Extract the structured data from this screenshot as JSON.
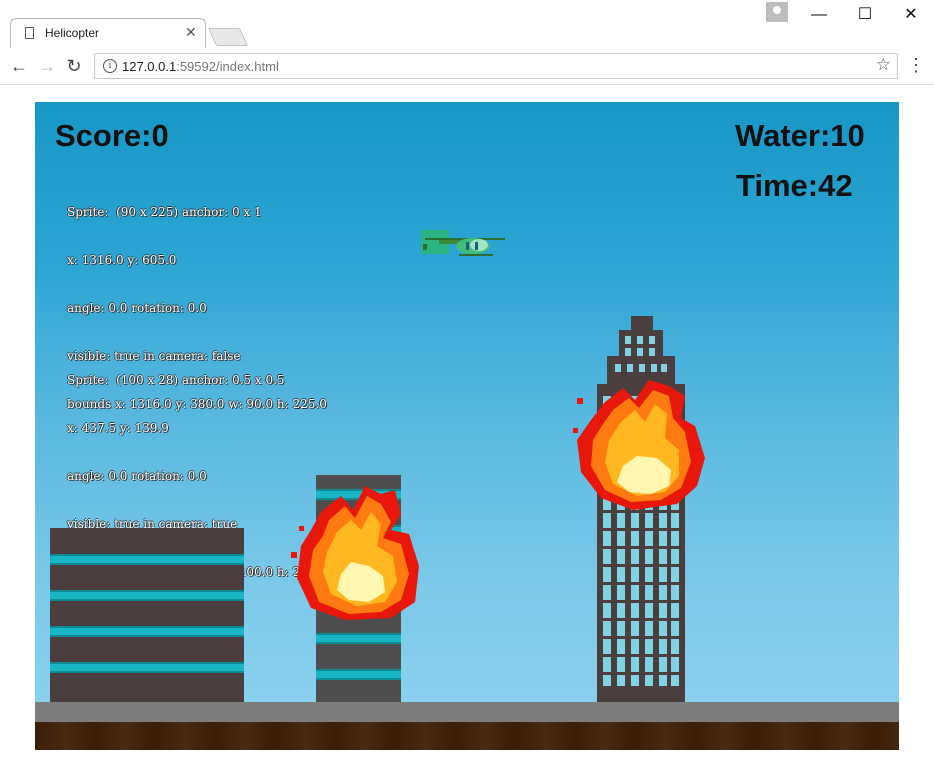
{
  "browser": {
    "tab_title": "Helicopter",
    "url_host": "127.0.0.1",
    "url_rest": ":59592/index.html"
  },
  "hud": {
    "score": "Score:0",
    "water": "Water:10",
    "time": "Time:42"
  },
  "debug": {
    "helicopter": [
      "Sprite:  (90 x 225) anchor: 0 x 1",
      "x: 1316.0 y: 605.0",
      "angle: 0.0 rotation: 0.0",
      "visible: true in camera: false",
      "bounds x: 1316.0 y: 380.0 w: 90.0 h: 225.0"
    ],
    "sprite2": [
      "Sprite:  (100 x 28) anchor: 0.5 x 0.5",
      "x: 437.5 y: 139.9",
      "angle: 0.0 rotation: 0.0",
      "visible: true in camera: true",
      "bounds x: 387.5 y: 125.9 w: 100.0 h: 28.0"
    ]
  },
  "colors": {
    "sky_top": "#1797c6",
    "sky_bottom": "#8ed3ef",
    "building": "#4a3e3e",
    "window": "#18b6c4",
    "road": "#7d7d7d",
    "dirt": "#3a1e08",
    "fire_outer": "#e8170c",
    "fire_mid": "#ff9a10",
    "fire_core": "#fff7b0"
  },
  "icons": {
    "back": "arrow-left-icon",
    "forward": "arrow-right-icon",
    "reload": "reload-icon",
    "info": "info-icon",
    "bookmark": "star-icon",
    "menu": "kebab-menu-icon"
  }
}
